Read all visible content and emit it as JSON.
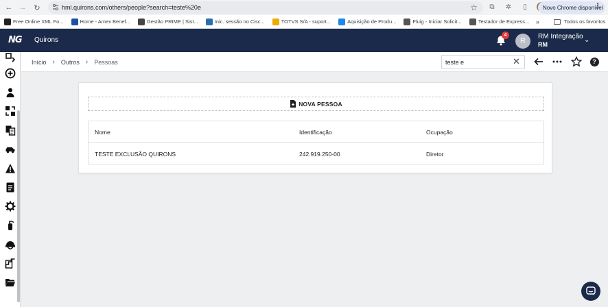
{
  "browser": {
    "url": "hml.quirons.com/others/people?search=teste%20e",
    "update_label": "Novo Chrome disponível",
    "bookmarks": [
      {
        "label": "Free Online XML Fo...",
        "color": "#222222"
      },
      {
        "label": "Home - Amex Benef...",
        "color": "#1e4fa0"
      },
      {
        "label": "Gestão PRIME | Sist...",
        "color": "#444444"
      },
      {
        "label": "Inic. sessão no Cisc...",
        "color": "#2b6cb0"
      },
      {
        "label": "TOTVS S/A - suport...",
        "color": "#f2a900"
      },
      {
        "label": "Aquisição de Produ...",
        "color": "#1e88e5"
      },
      {
        "label": "Fluig - Iniciar Solicit...",
        "color": "#555555"
      },
      {
        "label": "Testador de Express...",
        "color": "#555555"
      }
    ],
    "bookmarks_more": "»",
    "all_bookmarks_label": "Todos os favoritos"
  },
  "app": {
    "logo_mark": "NG",
    "logo_text": "Quirons",
    "notification_count": "4",
    "user_initial": "R",
    "user_name": "RM Integração",
    "user_sub": "RM",
    "header_color": "#1b2a4a"
  },
  "breadcrumb": {
    "items": [
      "Início",
      "Outros",
      "Pessoas"
    ]
  },
  "search": {
    "value": "teste e"
  },
  "page": {
    "new_button_label": "NOVA PESSOA",
    "columns": [
      "Nome",
      "Identificação",
      "Ocupação"
    ],
    "rows": [
      [
        "TESTE EXCLUSÃO QUIRONS",
        "242.919.250-00",
        "Diretor"
      ]
    ]
  },
  "sidebar_icons": [
    "menu-toggle-icon",
    "add-circle-icon",
    "people-icon",
    "transfer-icon",
    "documents-icon",
    "car-icon",
    "warning-icon",
    "clipboard-icon",
    "gear-icon",
    "extinguisher-icon",
    "helmet-icon",
    "stairs-icon",
    "folder-open-icon"
  ]
}
